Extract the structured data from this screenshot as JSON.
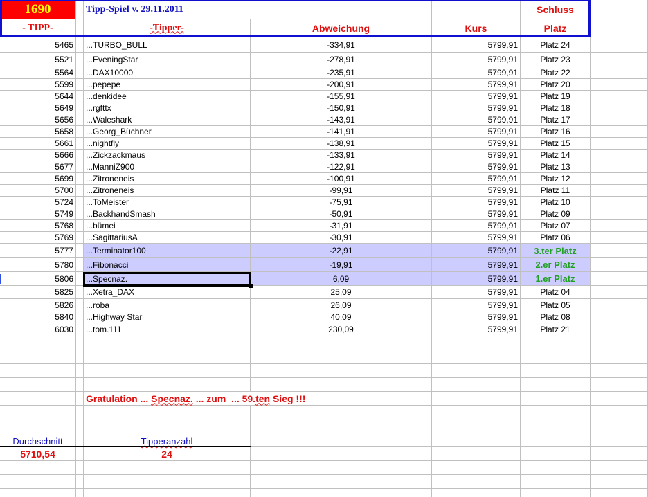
{
  "header": {
    "tipp_count": "1690",
    "title": "Tipp-Spiel v. 29.11.2011",
    "schluss": "Schluss",
    "col_tipp": "- TIPP-",
    "col_tipper": "-Tipper-",
    "col_abweichung": "Abweichung",
    "col_kurs": "Kurs",
    "col_platz": "Platz"
  },
  "colors": {
    "accent_red": "#ff0000",
    "tipp_yellow": "#ffff00",
    "frame_blue": "#1010d0",
    "highlight": "#ccccff",
    "winner_green": "#20a020"
  },
  "rows": [
    {
      "tipp": "5465",
      "tipper": "...TURBO_BULL",
      "abweichung": "-334,91",
      "kurs": "5799,91",
      "platz": "Platz 24"
    },
    {
      "tipp": "5521",
      "tipper": "...EveningStar",
      "abweichung": "-278,91",
      "kurs": "5799,91",
      "platz": "Platz 23"
    },
    {
      "tipp": "5564",
      "tipper": "...DAX10000",
      "abweichung": "-235,91",
      "kurs": "5799,91",
      "platz": "Platz 22"
    },
    {
      "tipp": "5599",
      "tipper": "...pepepe",
      "abweichung": "-200,91",
      "kurs": "5799,91",
      "platz": "Platz 20"
    },
    {
      "tipp": "5644",
      "tipper": "...denkidee",
      "abweichung": "-155,91",
      "kurs": "5799,91",
      "platz": "Platz 19"
    },
    {
      "tipp": "5649",
      "tipper": "...rgfttx",
      "abweichung": "-150,91",
      "kurs": "5799,91",
      "platz": "Platz 18"
    },
    {
      "tipp": "5656",
      "tipper": "...Waleshark",
      "abweichung": "-143,91",
      "kurs": "5799,91",
      "platz": "Platz 17"
    },
    {
      "tipp": "5658",
      "tipper": "...Georg_Büchner",
      "abweichung": "-141,91",
      "kurs": "5799,91",
      "platz": "Platz 16"
    },
    {
      "tipp": "5661",
      "tipper": "...nightfly",
      "abweichung": "-138,91",
      "kurs": "5799,91",
      "platz": "Platz 15"
    },
    {
      "tipp": "5666",
      "tipper": "...Zickzackmaus",
      "abweichung": "-133,91",
      "kurs": "5799,91",
      "platz": "Platz 14"
    },
    {
      "tipp": "5677",
      "tipper": "...ManniZ900",
      "abweichung": "-122,91",
      "kurs": "5799,91",
      "platz": "Platz 13"
    },
    {
      "tipp": "5699",
      "tipper": "...Zitroneneis",
      "abweichung": "-100,91",
      "kurs": "5799,91",
      "platz": "Platz 12"
    },
    {
      "tipp": "5700",
      "tipper": "...Zitroneneis",
      "abweichung": "-99,91",
      "kurs": "5799,91",
      "platz": "Platz 11"
    },
    {
      "tipp": "5724",
      "tipper": "...ToMeister",
      "abweichung": "-75,91",
      "kurs": "5799,91",
      "platz": "Platz 10"
    },
    {
      "tipp": "5749",
      "tipper": "...BackhandSmash",
      "abweichung": "-50,91",
      "kurs": "5799,91",
      "platz": "Platz 09"
    },
    {
      "tipp": "5768",
      "tipper": "...bümei",
      "abweichung": "-31,91",
      "kurs": "5799,91",
      "platz": "Platz 07"
    },
    {
      "tipp": "5769",
      "tipper": "...SagittariusA",
      "abweichung": "-30,91",
      "kurs": "5799,91",
      "platz": "Platz 06"
    },
    {
      "tipp": "5777",
      "tipper": "...Terminator100",
      "abweichung": "-22,91",
      "kurs": "5799,91",
      "platz": "3.ter Platz",
      "highlighted": true
    },
    {
      "tipp": "5780",
      "tipper": "...Fibonacci",
      "abweichung": "-19,91",
      "kurs": "5799,91",
      "platz": "2.er Platz",
      "highlighted": true
    },
    {
      "tipp": "5806",
      "tipper": "...Specnaz.",
      "abweichung": "6,09",
      "kurs": "5799,91",
      "platz": "1.er Platz",
      "highlighted": true
    },
    {
      "tipp": "5825",
      "tipper": "...Xetra_DAX",
      "abweichung": "25,09",
      "kurs": "5799,91",
      "platz": "Platz 04"
    },
    {
      "tipp": "5826",
      "tipper": "...roba",
      "abweichung": "26,09",
      "kurs": "5799,91",
      "platz": "Platz 05"
    },
    {
      "tipp": "5840",
      "tipper": "...Highway Star",
      "abweichung": "40,09",
      "kurs": "5799,91",
      "platz": "Platz 08"
    },
    {
      "tipp": "6030",
      "tipper": "...tom.111",
      "abweichung": "230,09",
      "kurs": "5799,91",
      "platz": "Platz 21"
    }
  ],
  "footer": {
    "gratulation_prefix": "Gratulation ... ",
    "winner": "Specnaz.",
    "gratulation_mid": " ... zum  ... 59.",
    "gratulation_ten": "ten",
    "gratulation_end": " Sieg !!!",
    "durchschnitt_label": "Durchschnitt",
    "durchschnitt_value": "5710,54",
    "tipperanzahl_label": "Tipperanzahl",
    "tipperanzahl_value": "24"
  }
}
